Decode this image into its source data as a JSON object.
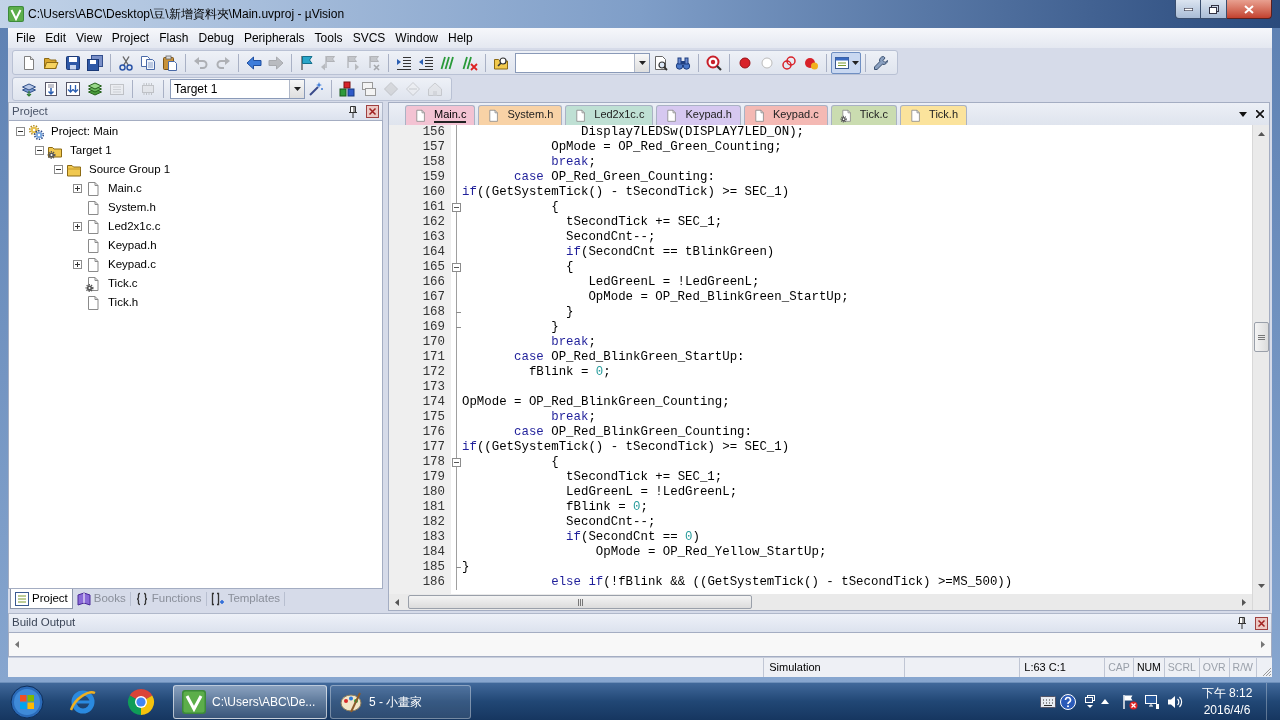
{
  "window": {
    "title": "C:\\Users\\ABC\\Desktop\\豆\\新增資料夾\\Main.uvproj - µVision"
  },
  "menu": [
    "File",
    "Edit",
    "View",
    "Project",
    "Flash",
    "Debug",
    "Peripherals",
    "Tools",
    "SVCS",
    "Window",
    "Help"
  ],
  "toolbars": [
    {
      "groups": [
        [
          {
            "kind": "new",
            "disabled": false
          },
          {
            "kind": "open",
            "disabled": false
          },
          {
            "kind": "save",
            "disabled": false
          },
          {
            "kind": "save_all",
            "disabled": false
          }
        ],
        [
          {
            "kind": "cut",
            "disabled": false
          },
          {
            "kind": "copy",
            "disabled": false
          },
          {
            "kind": "paste",
            "disabled": false
          }
        ],
        [
          {
            "kind": "undo",
            "disabled": true
          },
          {
            "kind": "redo",
            "disabled": true
          }
        ],
        [
          {
            "kind": "back",
            "disabled": false
          },
          {
            "kind": "forward",
            "disabled": true
          }
        ],
        [
          {
            "kind": "bookmark",
            "disabled": false
          },
          {
            "kind": "bookmark_prev",
            "disabled": true
          },
          {
            "kind": "bookmark_next",
            "disabled": true
          },
          {
            "kind": "bookmark_clear",
            "disabled": true
          }
        ],
        [
          {
            "kind": "indent",
            "disabled": false
          },
          {
            "kind": "unindent",
            "disabled": false
          },
          {
            "kind": "comment",
            "disabled": false
          },
          {
            "kind": "uncomment",
            "disabled": false
          }
        ],
        [
          {
            "kind": "find_in_files",
            "disabled": false
          },
          {
            "kind": "search_combo",
            "disabled": false
          },
          {
            "kind": "find",
            "disabled": false
          },
          {
            "kind": "incremental_find",
            "disabled": false
          }
        ],
        [
          {
            "kind": "debug",
            "disabled": false
          }
        ],
        [
          {
            "kind": "breakpoint",
            "disabled": false
          },
          {
            "kind": "breakpoint_off",
            "disabled": false
          },
          {
            "kind": "breakpoint_kill",
            "disabled": false
          },
          {
            "kind": "breakpoint_toggle",
            "disabled": false
          }
        ],
        [
          {
            "kind": "windows",
            "disabled": false,
            "pressed": true
          }
        ],
        [
          {
            "kind": "configure",
            "disabled": false
          }
        ]
      ]
    },
    {
      "groups": [
        [
          {
            "kind": "translate",
            "disabled": false
          },
          {
            "kind": "build",
            "disabled": false
          },
          {
            "kind": "rebuild",
            "disabled": false
          },
          {
            "kind": "batch_build",
            "disabled": false
          },
          {
            "kind": "stop_build",
            "disabled": true
          }
        ],
        [
          {
            "kind": "download",
            "disabled": true
          }
        ],
        [
          {
            "kind": "target_combo",
            "disabled": false,
            "value": "Target 1"
          },
          {
            "kind": "options",
            "disabled": false
          }
        ],
        [
          {
            "kind": "components",
            "disabled": false
          },
          {
            "kind": "project_items",
            "disabled": false
          },
          {
            "kind": "packs",
            "disabled": true
          },
          {
            "kind": "pack_installer",
            "disabled": true
          },
          {
            "kind": "environment",
            "disabled": true
          }
        ]
      ]
    }
  ],
  "project_panel": {
    "title": "Project",
    "tree": [
      {
        "label": "Project: Main",
        "kind": "project",
        "expanded": true,
        "children": [
          {
            "label": "Target 1",
            "kind": "target",
            "expanded": true,
            "children": [
              {
                "label": "Source Group 1",
                "kind": "group",
                "expanded": true,
                "children": [
                  {
                    "label": "Main.c",
                    "kind": "file",
                    "expanded": false
                  },
                  {
                    "label": "System.h",
                    "kind": "file"
                  },
                  {
                    "label": "Led2x1c.c",
                    "kind": "file",
                    "expanded": false
                  },
                  {
                    "label": "Keypad.h",
                    "kind": "file"
                  },
                  {
                    "label": "Keypad.c",
                    "kind": "file",
                    "expanded": false
                  },
                  {
                    "label": "Tick.c",
                    "kind": "file_options"
                  },
                  {
                    "label": "Tick.h",
                    "kind": "file"
                  }
                ]
              }
            ]
          }
        ]
      }
    ],
    "tabs": [
      {
        "label": "Project",
        "kind": "project",
        "selected": true
      },
      {
        "label": "Books",
        "kind": "books",
        "selected": false
      },
      {
        "label": "Functions",
        "kind": "functions",
        "selected": false
      },
      {
        "label": "Templates",
        "kind": "templates",
        "selected": false
      }
    ]
  },
  "editor": {
    "tabs": [
      {
        "label": "Main.c",
        "kind": "file",
        "color": "#f3c3d3",
        "selected": true
      },
      {
        "label": "System.h",
        "kind": "file",
        "color": "#f8d2a6",
        "selected": false
      },
      {
        "label": "Led2x1c.c",
        "kind": "file",
        "color": "#bfe0d4",
        "selected": false
      },
      {
        "label": "Keypad.h",
        "kind": "file",
        "color": "#d6c8f0",
        "selected": false
      },
      {
        "label": "Keypad.c",
        "kind": "file",
        "color": "#f4b9b4",
        "selected": false
      },
      {
        "label": "Tick.c",
        "kind": "file_options",
        "color": "#cadcb0",
        "selected": false
      },
      {
        "label": "Tick.h",
        "kind": "file",
        "color": "#fbe39c",
        "selected": false
      }
    ],
    "lines": [
      {
        "number": "156",
        "kind": "line",
        "tokens": [
          {
            "kind": "plain",
            "text": "                Display7LEDSw(DISPLAY7LED_ON);"
          }
        ]
      },
      {
        "number": "157",
        "kind": "line",
        "tokens": [
          {
            "kind": "plain",
            "text": "            OpMode = OP_Red_Green_Counting;"
          }
        ]
      },
      {
        "number": "158",
        "kind": "line",
        "tokens": [
          {
            "kind": "keyword",
            "text": "            break"
          },
          {
            "kind": "plain",
            "text": ";"
          }
        ]
      },
      {
        "number": "159",
        "kind": "line",
        "tokens": [
          {
            "kind": "keyword",
            "text": "       case"
          },
          {
            "kind": "plain",
            "text": " OP_Red_Green_Counting:"
          }
        ]
      },
      {
        "number": "160",
        "kind": "line",
        "tokens": [
          {
            "kind": "keyword",
            "text": "if"
          },
          {
            "kind": "plain",
            "text": "((GetSystemTick() - tSecondTick) >= SEC_1)"
          }
        ]
      },
      {
        "number": "161",
        "kind": "fold_start",
        "tokens": [
          {
            "kind": "plain",
            "text": "            {"
          }
        ]
      },
      {
        "number": "162",
        "kind": "line",
        "tokens": [
          {
            "kind": "plain",
            "text": "              tSecondTick += SEC_1;"
          }
        ]
      },
      {
        "number": "163",
        "kind": "line",
        "tokens": [
          {
            "kind": "plain",
            "text": "              SecondCnt--;"
          }
        ]
      },
      {
        "number": "164",
        "kind": "line",
        "tokens": [
          {
            "kind": "keyword",
            "text": "              if"
          },
          {
            "kind": "plain",
            "text": "(SecondCnt == tBlinkGreen)"
          }
        ]
      },
      {
        "number": "165",
        "kind": "fold_start",
        "tokens": [
          {
            "kind": "plain",
            "text": "              {"
          }
        ]
      },
      {
        "number": "166",
        "kind": "line",
        "tokens": [
          {
            "kind": "plain",
            "text": "                 LedGreenL = !LedGreenL;"
          }
        ]
      },
      {
        "number": "167",
        "kind": "line",
        "tokens": [
          {
            "kind": "plain",
            "text": "                 OpMode = OP_Red_BlinkGreen_StartUp;"
          }
        ]
      },
      {
        "number": "168",
        "kind": "fold_end",
        "tokens": [
          {
            "kind": "plain",
            "text": "              }"
          }
        ]
      },
      {
        "number": "169",
        "kind": "fold_end",
        "tokens": [
          {
            "kind": "plain",
            "text": "            }"
          }
        ]
      },
      {
        "number": "170",
        "kind": "line",
        "tokens": [
          {
            "kind": "keyword",
            "text": "            break"
          },
          {
            "kind": "plain",
            "text": ";"
          }
        ]
      },
      {
        "number": "171",
        "kind": "line",
        "tokens": [
          {
            "kind": "keyword",
            "text": "       case"
          },
          {
            "kind": "plain",
            "text": " OP_Red_BlinkGreen_StartUp:"
          }
        ]
      },
      {
        "number": "172",
        "kind": "line",
        "tokens": [
          {
            "kind": "plain",
            "text": "         fBlink = "
          },
          {
            "kind": "number",
            "text": "0"
          },
          {
            "kind": "plain",
            "text": ";"
          }
        ]
      },
      {
        "number": "173",
        "kind": "line"
      },
      {
        "number": "174",
        "kind": "line",
        "tokens": [
          {
            "kind": "plain",
            "text": "OpMode = OP_Red_BlinkGreen_Counting;"
          }
        ]
      },
      {
        "number": "175",
        "kind": "line",
        "tokens": [
          {
            "kind": "keyword",
            "text": "            break"
          },
          {
            "kind": "plain",
            "text": ";"
          }
        ]
      },
      {
        "number": "176",
        "kind": "line",
        "tokens": [
          {
            "kind": "keyword",
            "text": "       case"
          },
          {
            "kind": "plain",
            "text": " OP_Red_BlinkGreen_Counting:"
          }
        ]
      },
      {
        "number": "177",
        "kind": "line",
        "tokens": [
          {
            "kind": "keyword",
            "text": "if"
          },
          {
            "kind": "plain",
            "text": "((GetSystemTick() - tSecondTick) >= SEC_1)"
          }
        ]
      },
      {
        "number": "178",
        "kind": "fold_start",
        "tokens": [
          {
            "kind": "plain",
            "text": "            {"
          }
        ]
      },
      {
        "number": "179",
        "kind": "line",
        "tokens": [
          {
            "kind": "plain",
            "text": "              tSecondTick += SEC_1;"
          }
        ]
      },
      {
        "number": "180",
        "kind": "line",
        "tokens": [
          {
            "kind": "plain",
            "text": "              LedGreenL = !LedGreenL;"
          }
        ]
      },
      {
        "number": "181",
        "kind": "line",
        "tokens": [
          {
            "kind": "plain",
            "text": "              fBlink = "
          },
          {
            "kind": "number",
            "text": "0"
          },
          {
            "kind": "plain",
            "text": ";"
          }
        ]
      },
      {
        "number": "182",
        "kind": "line",
        "tokens": [
          {
            "kind": "plain",
            "text": "              SecondCnt--;"
          }
        ]
      },
      {
        "number": "183",
        "kind": "line",
        "tokens": [
          {
            "kind": "keyword",
            "text": "              if"
          },
          {
            "kind": "plain",
            "text": "(SecondCnt == "
          },
          {
            "kind": "number",
            "text": "0"
          },
          {
            "kind": "plain",
            "text": ")"
          }
        ]
      },
      {
        "number": "184",
        "kind": "line",
        "tokens": [
          {
            "kind": "plain",
            "text": "                  OpMode = OP_Red_Yellow_StartUp;"
          }
        ]
      },
      {
        "number": "185",
        "kind": "fold_end",
        "tokens": [
          {
            "kind": "plain",
            "text": "}"
          }
        ]
      },
      {
        "number": "186",
        "kind": "line",
        "tokens": [
          {
            "kind": "keyword",
            "text": "            else if"
          },
          {
            "kind": "plain",
            "text": "(!fBlink && ((GetSystemTick() - tSecondTick) >=MS_500))"
          }
        ]
      }
    ]
  },
  "build_output": {
    "title": "Build Output"
  },
  "status_bar": {
    "mode": "Simulation",
    "position": "L:63 C:1",
    "indicators": [
      {
        "label": "CAP",
        "on": false
      },
      {
        "label": "NUM",
        "on": true
      },
      {
        "label": "SCRL",
        "on": false
      },
      {
        "label": "OVR",
        "on": false
      },
      {
        "label": "R/W",
        "on": false
      }
    ]
  },
  "taskbar": {
    "tasks": [
      {
        "label": "C:\\Users\\ABC\\De...",
        "kind": "uvision",
        "selected": true
      },
      {
        "label": "5 - 小畫家",
        "kind": "paint",
        "selected": false
      }
    ],
    "clock": {
      "time": "下午 8:12",
      "date": "2016/4/6"
    }
  }
}
